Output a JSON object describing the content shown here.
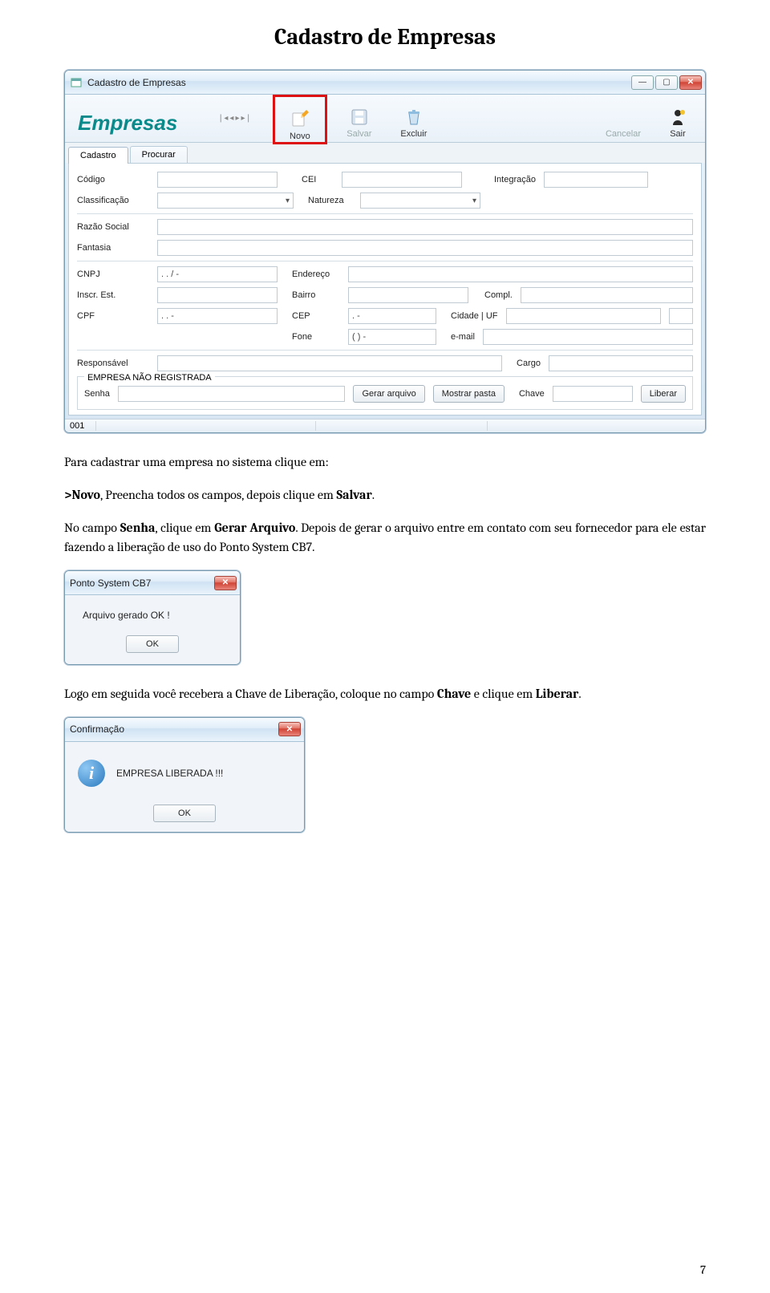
{
  "page": {
    "title": "Cadastro de Empresas",
    "number": "7"
  },
  "window1": {
    "title": "Cadastro de Empresas",
    "brand": "Empresas",
    "toolbar": {
      "novo": "Novo",
      "salvar": "Salvar",
      "excluir": "Excluir",
      "cancelar": "Cancelar",
      "sair": "Sair"
    },
    "tabs": {
      "cadastro": "Cadastro",
      "procurar": "Procurar"
    },
    "labels": {
      "codigo": "Código",
      "cei": "CEI",
      "integracao": "Integração",
      "classificacao": "Classificação",
      "natureza": "Natureza",
      "razao": "Razão Social",
      "fantasia": "Fantasia",
      "cnpj": "CNPJ",
      "endereco": "Endereço",
      "inscr": "Inscr. Est.",
      "bairro": "Bairro",
      "compl": "Compl.",
      "cpf": "CPF",
      "cep": "CEP",
      "cidadeuf": "Cidade | UF",
      "fone": "Fone",
      "email": "e-mail",
      "responsavel": "Responsável",
      "cargo": "Cargo",
      "senha": "Senha",
      "chave": "Chave"
    },
    "values": {
      "cnpj": ".   .   /   -",
      "cpf": ".   .   -",
      "cep": ".   -",
      "fone": "(   )   -"
    },
    "fieldset": {
      "legend": "EMPRESA NÃO REGISTRADA"
    },
    "buttons": {
      "gerar": "Gerar arquivo",
      "mostrar": "Mostrar pasta",
      "liberar": "Liberar"
    },
    "status": "001"
  },
  "paragraph1": {
    "p1a": "Para cadastrar uma empresa no sistema clique em:",
    "p1b": ">Novo",
    "p1c": ", Preencha todos os campos, depois clique em ",
    "p1d": "Salvar",
    "p1e": ".",
    "p2a": "No campo ",
    "p2b": "Senha",
    "p2c": ", clique em ",
    "p2d": "Gerar Arquivo",
    "p2e": ". Depois de gerar o arquivo entre em contato com seu fornecedor para ele estar fazendo a liberação de uso do Ponto System CB7."
  },
  "dialog1": {
    "title": "Ponto System CB7",
    "message": "Arquivo gerado OK !",
    "ok": "OK"
  },
  "paragraph2": {
    "a": "Logo em seguida você recebera a Chave de Liberação, coloque no campo ",
    "b": "Chave",
    "c": " e clique em ",
    "d": "Liberar",
    "e": "."
  },
  "dialog2": {
    "title": "Confirmação",
    "message": "EMPRESA LIBERADA !!!",
    "ok": "OK"
  }
}
